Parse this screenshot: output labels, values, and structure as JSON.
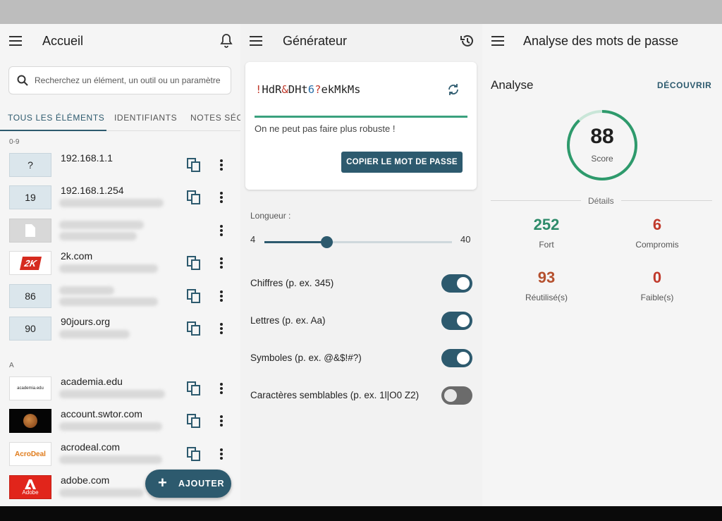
{
  "home": {
    "title": "Accueil",
    "search_placeholder": "Recherchez un élément, un outil ou un paramètre",
    "tabs": [
      "TOUS LES ÉLÉMENTS",
      "IDENTIFIANTS",
      "NOTES SÉCU"
    ],
    "sections": [
      "0-9",
      "A"
    ],
    "items": [
      {
        "thumb": "?",
        "name": "192.168.1.1"
      },
      {
        "thumb": "19",
        "name": "192.168.1.254"
      },
      {
        "thumb": "",
        "name": ""
      },
      {
        "thumb": "2K",
        "name": "2k.com"
      },
      {
        "thumb": "86",
        "name": ""
      },
      {
        "thumb": "90",
        "name": "90jours.org"
      },
      {
        "thumb": "academia.edu",
        "name": "academia.edu"
      },
      {
        "thumb": "",
        "name": "account.swtor.com"
      },
      {
        "thumb": "AcroDeal",
        "name": "acrodeal.com"
      },
      {
        "thumb": "Adobe",
        "name": "adobe.com"
      }
    ],
    "fab_label": "AJOUTER"
  },
  "generator": {
    "title": "Générateur",
    "password": "!HdR&DHt6?ekMkMs",
    "strength_text": "On ne peut pas faire plus robuste !",
    "copy_label": "COPIER LE MOT DE PASSE",
    "length_label": "Longueur :",
    "length_min": "4",
    "length_max": "40",
    "length_value": 16,
    "options": [
      {
        "label": "Chiffres (p. ex. 345)",
        "on": true
      },
      {
        "label": "Lettres (p. ex. Aa)",
        "on": true
      },
      {
        "label": "Symboles (p. ex. @&$!#?)",
        "on": true
      },
      {
        "label": "Caractères semblables (p. ex. 1l|O0 Z2)",
        "on": false
      }
    ]
  },
  "analysis": {
    "title": "Analyse des mots de passe",
    "section_title": "Analyse",
    "discover_label": "DÉCOUVRIR",
    "score": "88",
    "score_label": "Score",
    "details_label": "Détails",
    "stats": [
      {
        "value": "252",
        "label": "Fort",
        "color": "#2e8b6a"
      },
      {
        "value": "6",
        "label": "Compromis",
        "color": "#c0392b"
      },
      {
        "value": "93",
        "label": "Réutilisé(s)",
        "color": "#b5502e"
      },
      {
        "value": "0",
        "label": "Faible(s)",
        "color": "#c0392b"
      }
    ]
  },
  "colors": {
    "accent": "#2d5a6e",
    "strong": "#3aa17e"
  }
}
